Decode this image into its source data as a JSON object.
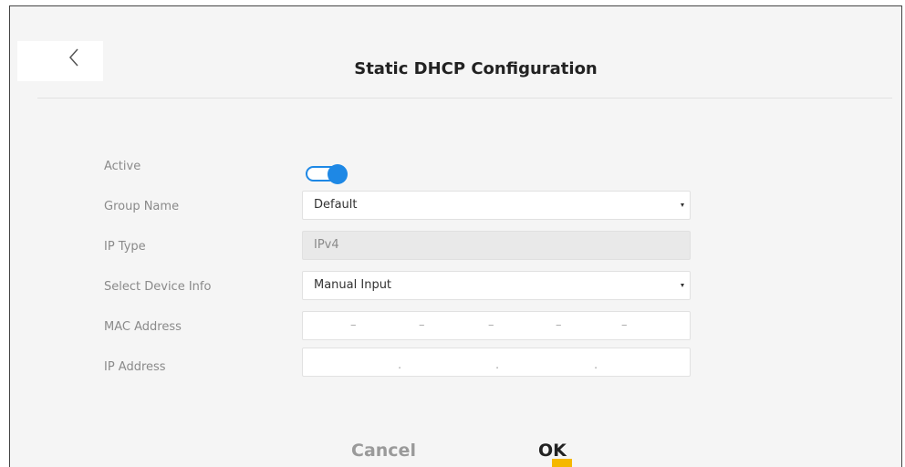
{
  "dialog": {
    "title": "Static DHCP Configuration"
  },
  "form": {
    "active_label": "Active",
    "active_on": true,
    "group_name_label": "Group Name",
    "group_name_value": "Default",
    "ip_type_label": "IP Type",
    "ip_type_value": "IPv4",
    "select_device_label": "Select Device Info",
    "select_device_value": "Manual Input",
    "mac_label": "MAC Address",
    "mac_separator": "–",
    "ip_label": "IP Address",
    "ip_separator": "."
  },
  "footer": {
    "cancel_label": "Cancel",
    "ok_label": "OK"
  },
  "colors": {
    "accent": "#1e88e5",
    "ok_highlight": "#f5b800"
  }
}
